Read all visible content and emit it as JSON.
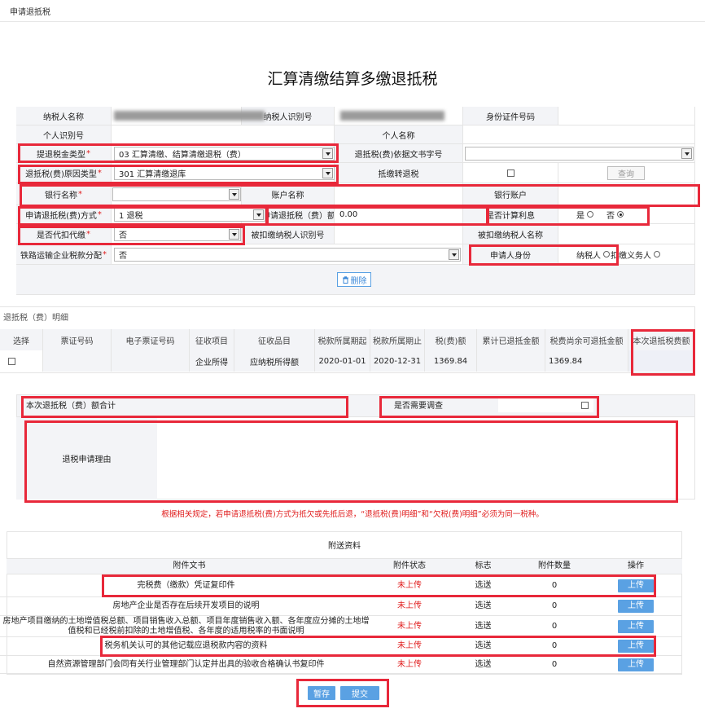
{
  "breadcrumb": "申请退抵税",
  "title": "汇算清缴结算多缴退抵税",
  "form": {
    "taxpayer_name_label": "纳税人名称",
    "taxpayer_id_label": "纳税人识别号",
    "id_doc_label": "身份证件号码",
    "personal_id_label": "个人识别号",
    "personal_name_label": "个人名称",
    "refund_type_label": "提退税金类型",
    "refund_type_value": "03 汇算清缴、结算清缴退税（费）",
    "basis_doc_label": "退抵税(费)依据文书字号",
    "reason_type_label": "退抵税(费)原因类型",
    "reason_type_value": "301 汇算清缴退库",
    "offset_label": "抵缴转退税",
    "query_button": "查询",
    "bank_name_label": "银行名称",
    "account_name_label": "账户名称",
    "bank_account_label": "银行账户",
    "method_label": "申请退抵税(费)方式",
    "method_value": "1 退税",
    "amount_label": "申请退抵税（费）额",
    "amount_value": "0.00",
    "interest_label": "是否计算利息",
    "yes": "是",
    "no": "否",
    "withhold_label": "是否代扣代缴",
    "withhold_value": "否",
    "withheld_id_label": "被扣缴纳税人识别号",
    "withheld_name_label": "被扣缴纳税人名称",
    "railway_label": "铁路运输企业税款分配",
    "railway_value": "否",
    "applicant_label": "申请人身份",
    "taxpayer_option": "纳税人",
    "withholder_option": "扣缴义务人",
    "delete_button": "删除"
  },
  "detail": {
    "section_title": "退抵税（费）明细",
    "columns": [
      "选择",
      "票证号码",
      "电子票证号码",
      "征收项目",
      "征收品目",
      "税款所属期起",
      "税款所属期止",
      "税(费)额",
      "累计已退抵金额",
      "税费尚余可退抵金额",
      "本次退抵税费额"
    ],
    "rows": [
      {
        "ticket_no": "",
        "e_ticket_no": "",
        "item": "企业所得",
        "sub_item": "应纳税所得额",
        "start": "2020-01-01",
        "end": "2020-12-31",
        "amount": "1369.84",
        "refunded": "",
        "remaining": "1369.84",
        "this_time": ""
      }
    ]
  },
  "summary": {
    "total_label": "本次退抵税（费）额合计",
    "survey_label": "是否需要调查",
    "reason_label": "退税申请理由"
  },
  "notice": "根据相关规定，若申请退抵税(费)方式为抵欠或先抵后退，“退抵税(费)明细”和“欠税(费)明细”必须为同一税种。",
  "attachments": {
    "section_title": "附送资料",
    "columns": [
      "附件文书",
      "附件状态",
      "标志",
      "附件数量",
      "操作"
    ],
    "rows": [
      {
        "name": "完税费（缴款）凭证复印件",
        "status": "未上传",
        "flag": "选送",
        "count": "0",
        "action": "上传"
      },
      {
        "name": "房地产企业是否存在后续开发项目的说明",
        "status": "未上传",
        "flag": "选送",
        "count": "0",
        "action": "上传"
      },
      {
        "name": "房地产项目缴纳的土地增值税总额、项目销售收入总额、项目年度销售收入额、各年度应分摊的土地增值税和已经税前扣除的土地增值税、各年度的适用税率的书面说明",
        "status": "未上传",
        "flag": "选送",
        "count": "0",
        "action": "上传"
      },
      {
        "name": "税务机关认可的其他记载应退税款内容的资料",
        "status": "未上传",
        "flag": "选送",
        "count": "0",
        "action": "上传"
      },
      {
        "name": "自然资源管理部门会同有关行业管理部门认定并出具的验收合格确认书复印件",
        "status": "未上传",
        "flag": "选送",
        "count": "0",
        "action": "上传"
      }
    ]
  },
  "footer": {
    "save_button": "暂存",
    "submit_button": "提交"
  },
  "colors": {
    "highlight": "#e8283a",
    "button_blue": "#5aa1e3",
    "status_red": "#e01c1c",
    "label_bg": "#f3f4f7"
  }
}
